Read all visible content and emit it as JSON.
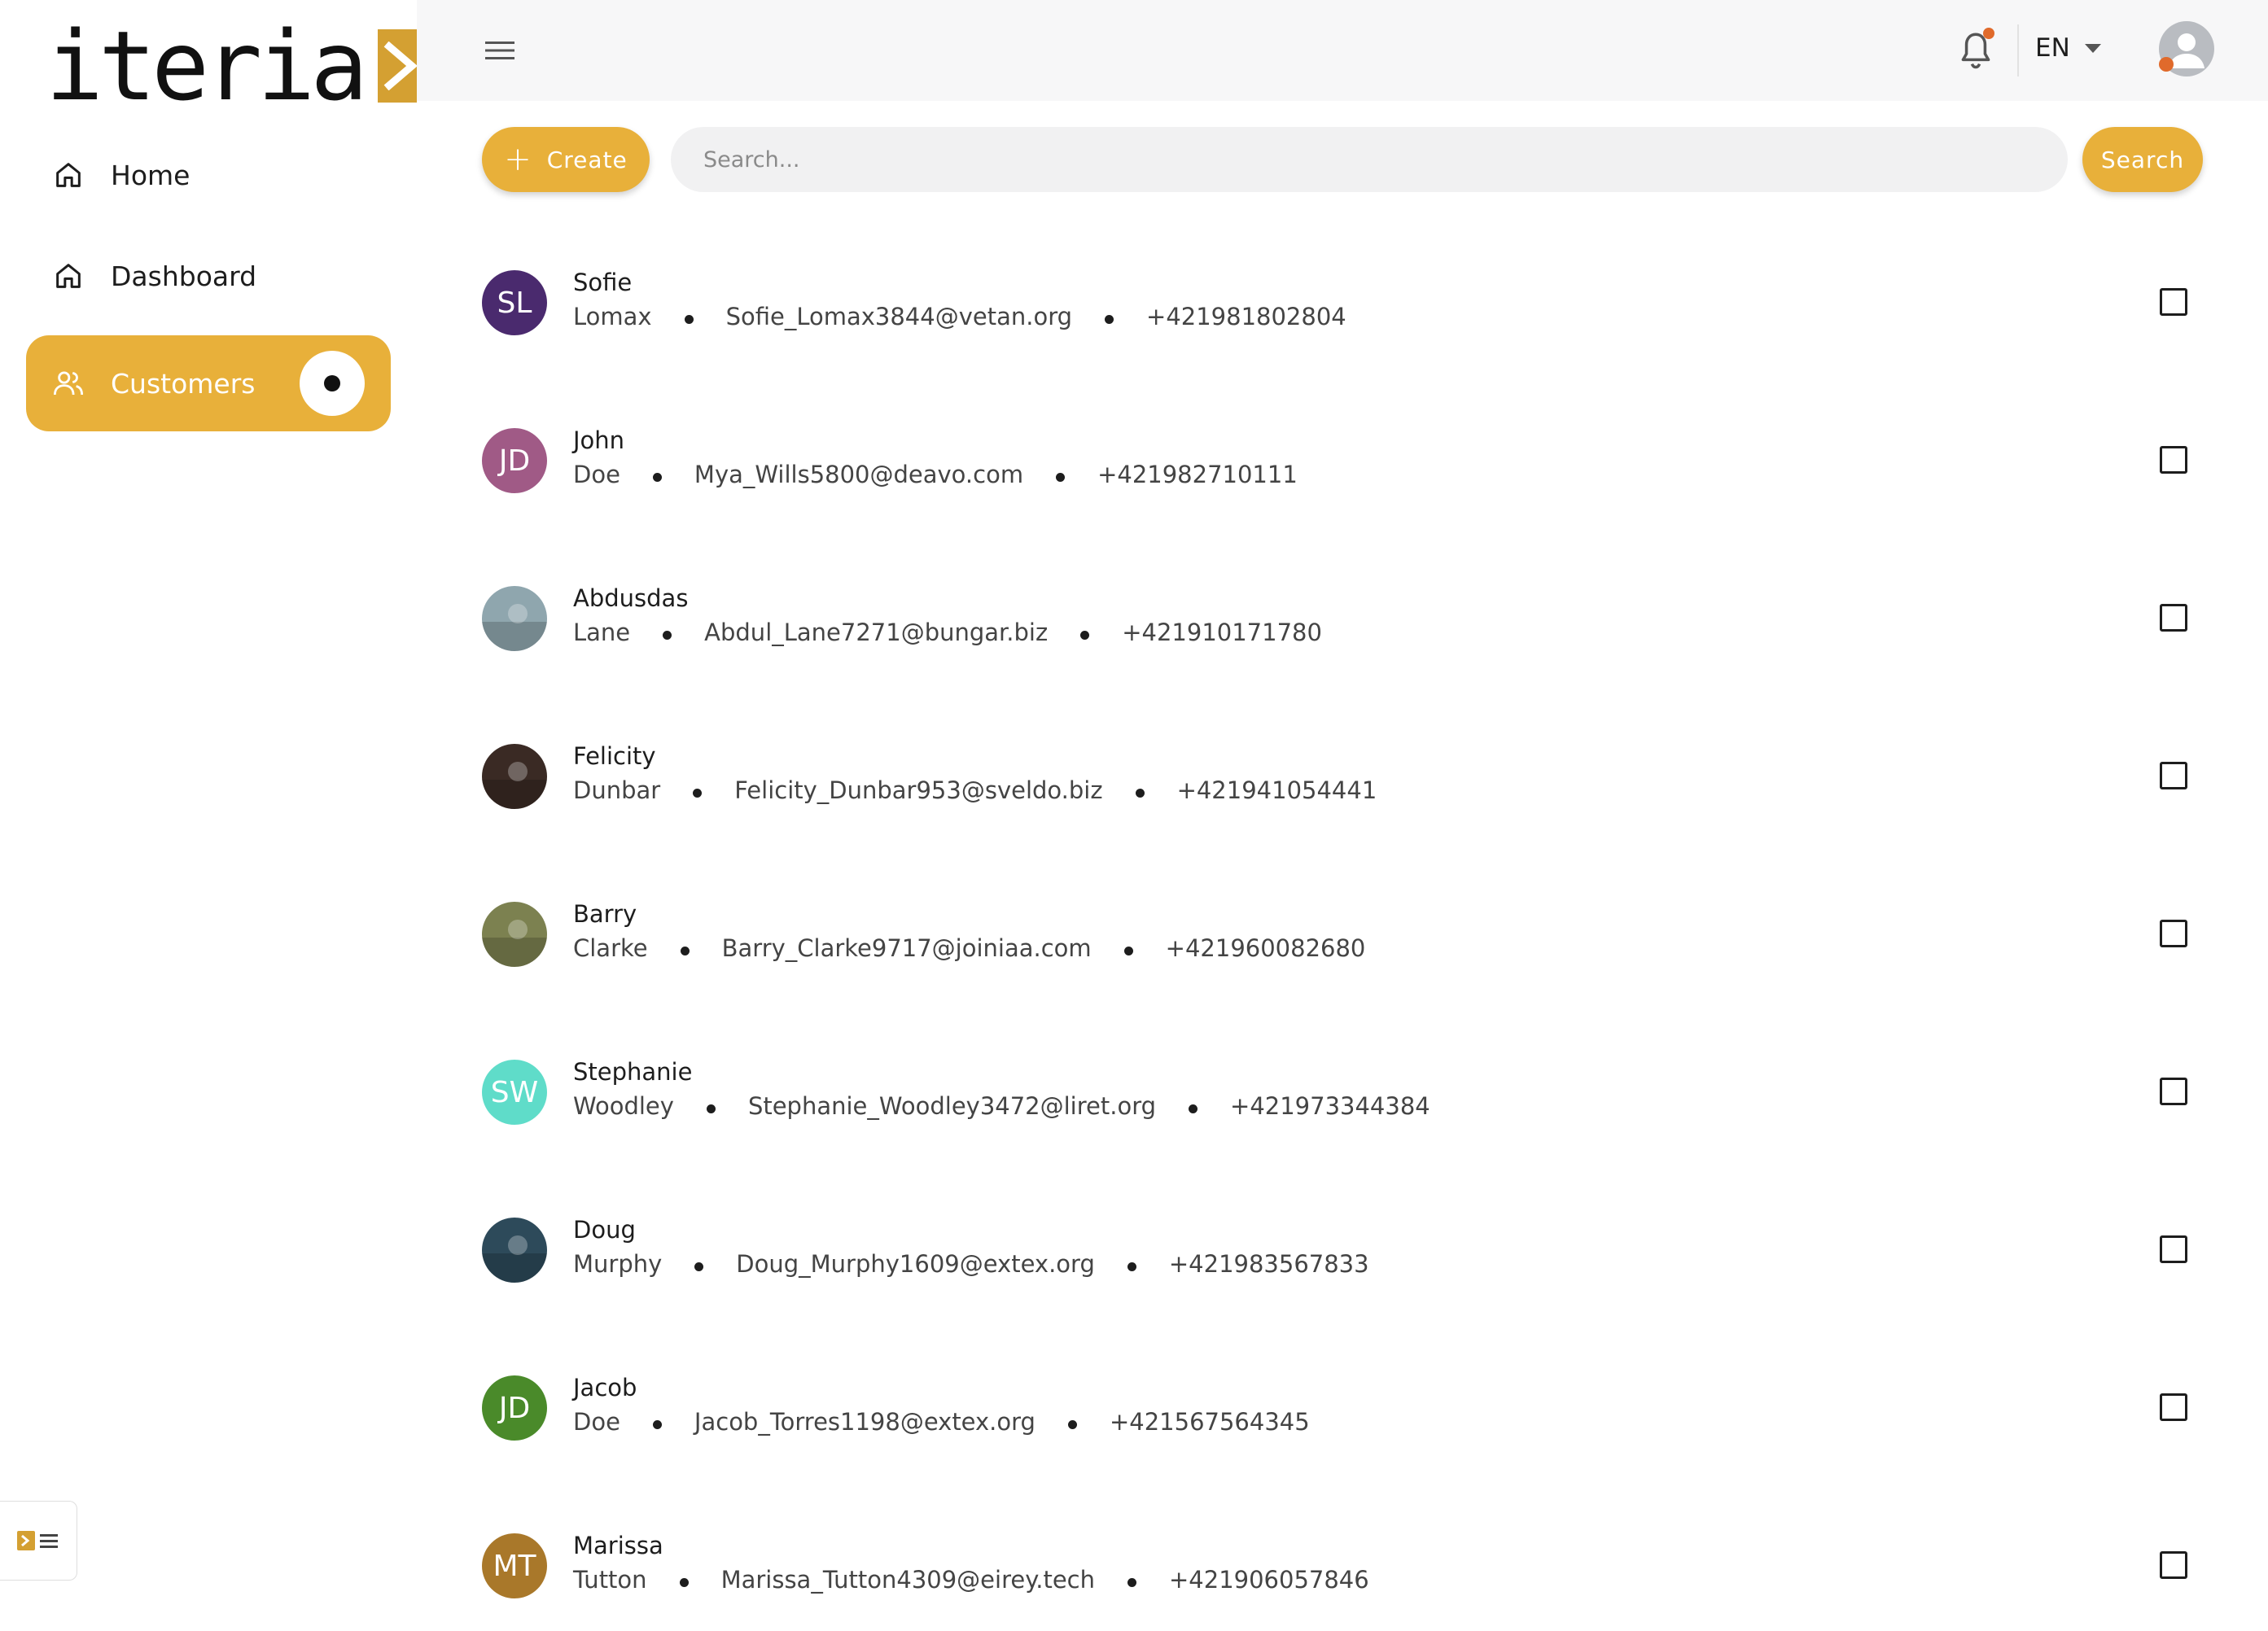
{
  "brand": {
    "logo_text": "iteria",
    "accent_color": "#e8b03a"
  },
  "sidebar": {
    "items": [
      {
        "label": "Home",
        "icon": "home-icon",
        "active": false
      },
      {
        "label": "Dashboard",
        "icon": "home-icon",
        "active": false
      },
      {
        "label": "Customers",
        "icon": "users-icon",
        "active": true
      }
    ]
  },
  "topbar": {
    "language": "EN",
    "notification_dot_color": "#e06a2b"
  },
  "toolbar": {
    "create_label": "Create",
    "search_placeholder": "Search...",
    "search_value": "",
    "search_button_label": "Search"
  },
  "customers": [
    {
      "first_name": "Sofie",
      "last_name": "Lomax",
      "email": "Sofie_Lomax3844@vetan.org",
      "phone": "+421981802804",
      "initials": "SL",
      "avatar_color": "#4a2a6e",
      "avatar_type": "initials"
    },
    {
      "first_name": "John",
      "last_name": "Doe",
      "email": "Mya_Wills5800@deavo.com",
      "phone": "+421982710111",
      "initials": "JD",
      "avatar_color": "#a05a86",
      "avatar_type": "initials"
    },
    {
      "first_name": "Abdusdas",
      "last_name": "Lane",
      "email": "Abdul_Lane7271@bungar.biz",
      "phone": "+421910171780",
      "initials": "",
      "avatar_color": "#8fa6ae",
      "avatar_type": "photo"
    },
    {
      "first_name": "Felicity",
      "last_name": "Dunbar",
      "email": "Felicity_Dunbar953@sveldo.biz",
      "phone": "+421941054441",
      "initials": "",
      "avatar_color": "#3a2a24",
      "avatar_type": "photo"
    },
    {
      "first_name": "Barry",
      "last_name": "Clarke",
      "email": "Barry_Clarke9717@joiniaa.com",
      "phone": "+421960082680",
      "initials": "",
      "avatar_color": "#7c8150",
      "avatar_type": "photo"
    },
    {
      "first_name": "Stephanie",
      "last_name": "Woodley",
      "email": "Stephanie_Woodley3472@liret.org",
      "phone": "+421973344384",
      "initials": "SW",
      "avatar_color": "#5fdcc9",
      "avatar_type": "initials"
    },
    {
      "first_name": "Doug",
      "last_name": "Murphy",
      "email": "Doug_Murphy1609@extex.org",
      "phone": "+421983567833",
      "initials": "",
      "avatar_color": "#2d4a5a",
      "avatar_type": "photo"
    },
    {
      "first_name": "Jacob",
      "last_name": "Doe",
      "email": "Jacob_Torres1198@extex.org",
      "phone": "+421567564345",
      "initials": "JD",
      "avatar_color": "#4a8a2a",
      "avatar_type": "initials"
    },
    {
      "first_name": "Marissa",
      "last_name": "Tutton",
      "email": "Marissa_Tutton4309@eirey.tech",
      "phone": "+421906057846",
      "initials": "MT",
      "avatar_color": "#a9782a",
      "avatar_type": "initials"
    }
  ]
}
